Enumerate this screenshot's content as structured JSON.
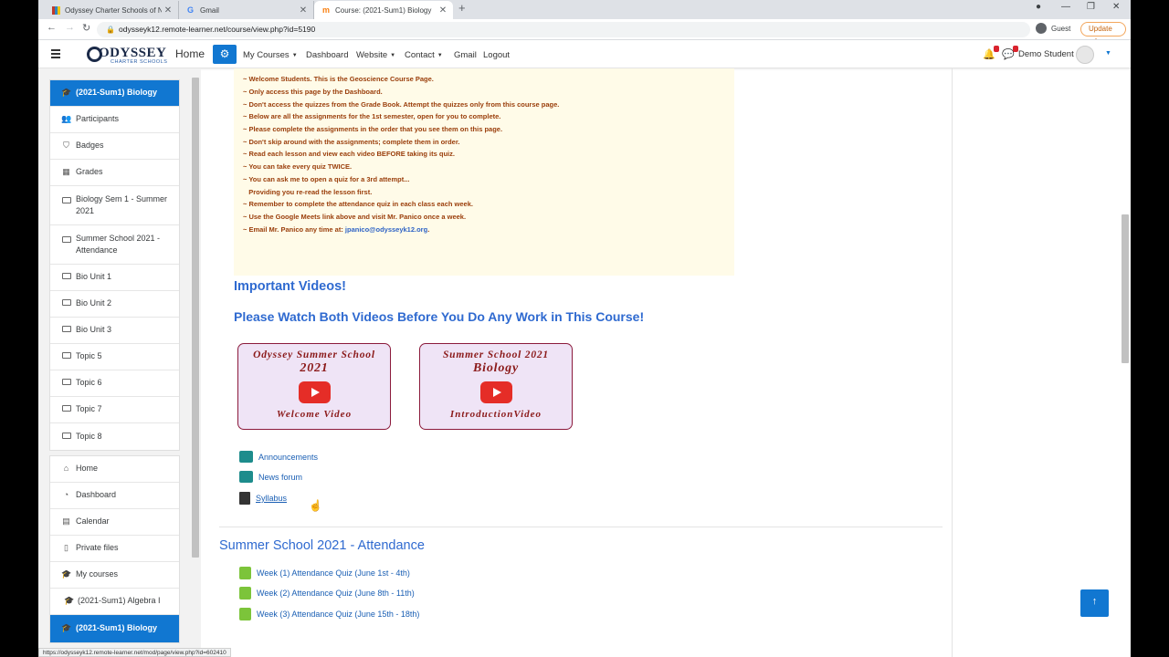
{
  "tabs": [
    {
      "label": "Odyssey Charter Schools of Neva"
    },
    {
      "label": "Gmail"
    },
    {
      "label": "Course: (2021-Sum1) Biology"
    }
  ],
  "address": {
    "url": "odysseyk12.remote-learner.net/course/view.php?id=5190"
  },
  "browser": {
    "guest_label": "Guest",
    "update_label": "Update"
  },
  "navbar": {
    "home": "Home",
    "items": [
      "My Courses",
      "Dashboard",
      "Website",
      "Contact",
      "Gmail",
      "Logout"
    ],
    "user": "Demo Student"
  },
  "logo": {
    "name": "ODYSSEY",
    "tagline": "CHARTER SCHOOLS"
  },
  "drawer": {
    "group1": [
      "(2021-Sum1) Biology",
      "Participants",
      "Badges",
      "Grades",
      "Biology Sem 1 - Summer 2021",
      "Summer School 2021 - Attendance",
      "Bio Unit 1",
      "Bio Unit 2",
      "Bio Unit 3",
      "Topic 5",
      "Topic 6",
      "Topic 7",
      "Topic 8"
    ],
    "group2": [
      "Home",
      "Dashboard",
      "Calendar",
      "Private files",
      "My courses",
      "(2021-Sum1) Algebra I",
      "(2021-Sum1) Biology"
    ]
  },
  "welcome": {
    "lines": [
      "~ Welcome Students. This is the Geoscience Course Page.",
      "~ Only access this page by the Dashboard.",
      "~ Don't access the quizzes from the Grade Book. Attempt the quizzes only from this      course page.",
      "~ Below are all the assignments for the 1st semester, open for you to complete.",
      "~ Please complete the assignments in the order that you see them on this page.",
      "~ Don't skip around with the assignments; complete them in order.",
      "~ Read each lesson and view each video BEFORE taking its quiz.",
      "~ You can take every quiz TWICE.",
      "~ You can ask me to open a quiz for a 3rd attempt...",
      "   Providing you re-read the lesson first.",
      "~ Remember to complete the attendance quiz in each class each week.",
      "~ Use the Google Meets link above and visit Mr. Panico once a week."
    ],
    "email_prefix": "~ Email Mr. Panico any time at: ",
    "email": "jpanico@odysseyk12.org",
    "email_suffix": "."
  },
  "headings": {
    "videos": "Important Videos!",
    "watch": "Please Watch Both Videos Before You Do Any Work in This Course!"
  },
  "videos": [
    {
      "line1": "Odyssey Summer School",
      "line2": "2021",
      "line3": "Welcome Video"
    },
    {
      "line1": "Summer School 2021",
      "line2": "Biology",
      "line3": "IntroductionVideo"
    }
  ],
  "activities": [
    "Announcements",
    "News forum",
    "Syllabus"
  ],
  "section": {
    "title": "Summer School 2021 - Attendance",
    "quizzes": [
      "Week (1) Attendance Quiz (June 1st - 4th)",
      "Week (2) Attendance Quiz (June 8th - 11th)",
      "Week (3) Attendance Quiz (June 15th - 18th)"
    ]
  },
  "status_url": "https://odysseyk12.remote-learner.net/mod/page/view.php?id=602410"
}
